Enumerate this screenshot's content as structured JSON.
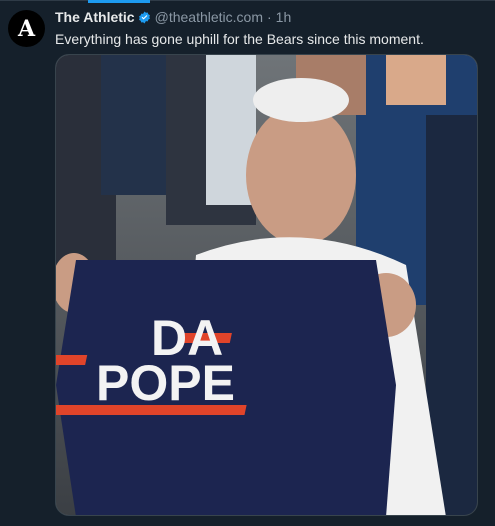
{
  "tweet": {
    "avatar_letter": "A",
    "display_name": "The Athletic",
    "handle": "@theathletic.com",
    "separator": "·",
    "time": "1h",
    "text": "Everything has gone uphill for the Bears since this moment.",
    "verified": true
  },
  "media": {
    "shirt_line1": "DA",
    "shirt_line2": "POPE"
  },
  "colors": {
    "background": "#15202b",
    "text": "#e7e9ea",
    "muted": "#8b98a5",
    "accent": "#1d9bf0",
    "shirt_navy": "#1c2550",
    "shirt_orange": "#e0442a"
  },
  "icons": {
    "verified": "verified-badge-icon"
  }
}
